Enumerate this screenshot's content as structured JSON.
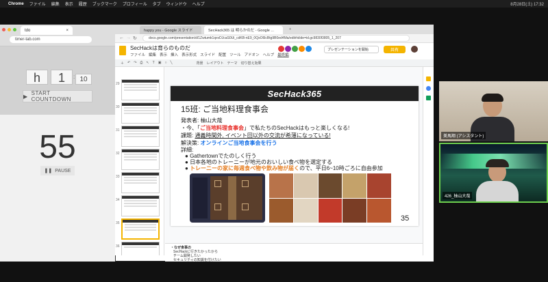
{
  "menubar": {
    "app": "Chrome",
    "menus": [
      "ファイル",
      "編集",
      "表示",
      "履歴",
      "ブックマーク",
      "プロフィール",
      "タブ",
      "ウィンドウ",
      "ヘルプ"
    ],
    "datetime": "8月28日(土) 17:32"
  },
  "timer_window": {
    "tab_title": "tdo",
    "url": "timer-tab.com",
    "hours": "h",
    "hours_value": "1",
    "minutes_value": ":",
    "seconds_value": "10",
    "start_label": "START COUNTDOWN",
    "countdown": "55",
    "pause_label": "PAUSE"
  },
  "browser": {
    "tabs": [
      "happy you - Google スライド",
      "SecHack365 は 明らかのだ - Google ..."
    ],
    "url": "docs.google.com/presentation/d/1Zwtumk1qxvDJcaS0Ui_cdKB-nE9_0QsO6lcBtg9B0ed4Ma/edit#slide=id.gc9830f3805_1_207",
    "doc_title": "SecHackは育らのものだ",
    "menus": [
      "ファイル",
      "編集",
      "表示",
      "挿入",
      "表示形式",
      "スライド",
      "配置",
      "ツール",
      "アドオン",
      "ヘルプ",
      "最終編"
    ],
    "present_label": "プレゼンテーションを開始",
    "share_label": "共有",
    "toolbar_items": [
      "背景",
      "レイアウト",
      "テーマ",
      "切り替え効果"
    ],
    "thumb_numbers": [
      "29",
      "30",
      "31",
      "32",
      "33",
      "34",
      "35",
      "36"
    ],
    "notes_lines": [
      "・なぜ食事の",
      "SecHackに行きたかったから",
      "チーム開発したい",
      "セキュリティの知識を付けたい"
    ]
  },
  "slide": {
    "banner": "SecHack365",
    "title": "15班: ご当地料理食事会",
    "presenter": "発表者: 柚山大哉",
    "line1_pre": "・今、「",
    "line1_highlight": "ご当地料理食事会",
    "line1_post": "」で私たちのSecHackはもっと楽しくなる!",
    "problem_label": "課題: ",
    "problem_text": "通義時間外, イベント回以外の交流が希薄になっている!",
    "solution_label": "解決策: ",
    "solution_text": "オンラインご当地食事会を行う",
    "details_label": "詳細:",
    "bullets": [
      "Gathertownでたのしく行う",
      "日本各地のトレーニーが地元のおいしい食べ物を選定する"
    ],
    "bullet3_highlight": "トレーニーの家に毎週食べ物や飲み物が届く",
    "bullet3_post": "ので、平日6~10時ごろに自由参加",
    "page_number": "35"
  },
  "participants": [
    {
      "label": "美馬翔 (アシスタント)"
    },
    {
      "label": "426_柚山大哉"
    }
  ],
  "colors": {
    "accent_red": "#e8302a",
    "accent_blue": "#1a73e8",
    "orange": "#e67e22"
  }
}
